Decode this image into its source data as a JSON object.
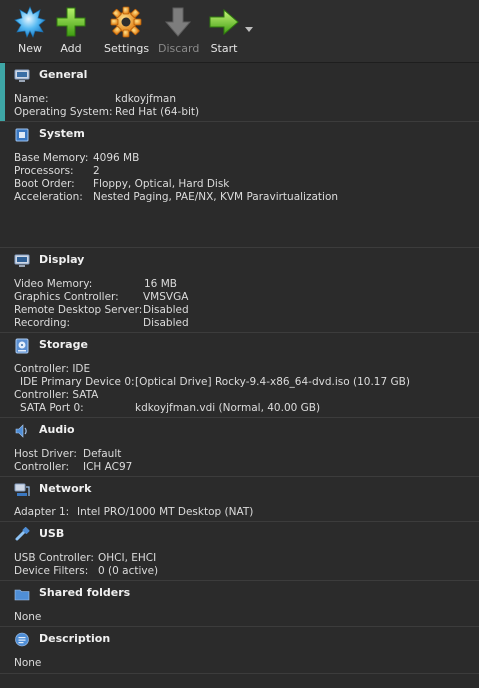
{
  "toolbar": {
    "new": "New",
    "add": "Add",
    "settings": "Settings",
    "discard": "Discard",
    "start": "Start"
  },
  "general": {
    "title": "General",
    "name_label": "Name:",
    "name": "kdkoyjfman",
    "os_label": "Operating System:",
    "os": "Red Hat (64-bit)"
  },
  "system": {
    "title": "System",
    "mem_label": "Base Memory:",
    "mem": "4096 MB",
    "proc_label": "Processors:",
    "proc": "2",
    "boot_label": "Boot Order:",
    "boot": "Floppy, Optical, Hard Disk",
    "accel_label": "Acceleration:",
    "accel": "Nested Paging, PAE/NX, KVM Paravirtualization"
  },
  "display": {
    "title": "Display",
    "vmem_label": "Video Memory:",
    "vmem": "16 MB",
    "gc_label": "Graphics Controller:",
    "gc": "VMSVGA",
    "rds_label": "Remote Desktop Server:",
    "rds": "Disabled",
    "rec_label": "Recording:",
    "rec": "Disabled"
  },
  "storage": {
    "title": "Storage",
    "ctrl_ide": "Controller: IDE",
    "ide_dev_label": "IDE Primary Device 0:",
    "ide_dev": "[Optical Drive] Rocky-9.4-x86_64-dvd.iso (10.17 GB)",
    "ctrl_sata": "Controller: SATA",
    "sata_port_label": "SATA Port 0:",
    "sata_port": "kdkoyjfman.vdi (Normal, 40.00 GB)"
  },
  "audio": {
    "title": "Audio",
    "host_label": "Host Driver:",
    "host": "Default",
    "ctrl_label": "Controller:",
    "ctrl": "ICH AC97"
  },
  "network": {
    "title": "Network",
    "adapter_label": "Adapter 1:",
    "adapter": "Intel PRO/1000 MT Desktop (NAT)"
  },
  "usb": {
    "title": "USB",
    "ctrl_label": "USB Controller:",
    "ctrl": "OHCI, EHCI",
    "filters_label": "Device Filters:",
    "filters": "0 (0 active)"
  },
  "shared": {
    "title": "Shared folders",
    "value": "None"
  },
  "description": {
    "title": "Description",
    "value": "None"
  },
  "colors": {
    "accent": "#3ea6a6",
    "background": "#2b2b2b",
    "text": "#e2e2e2"
  }
}
